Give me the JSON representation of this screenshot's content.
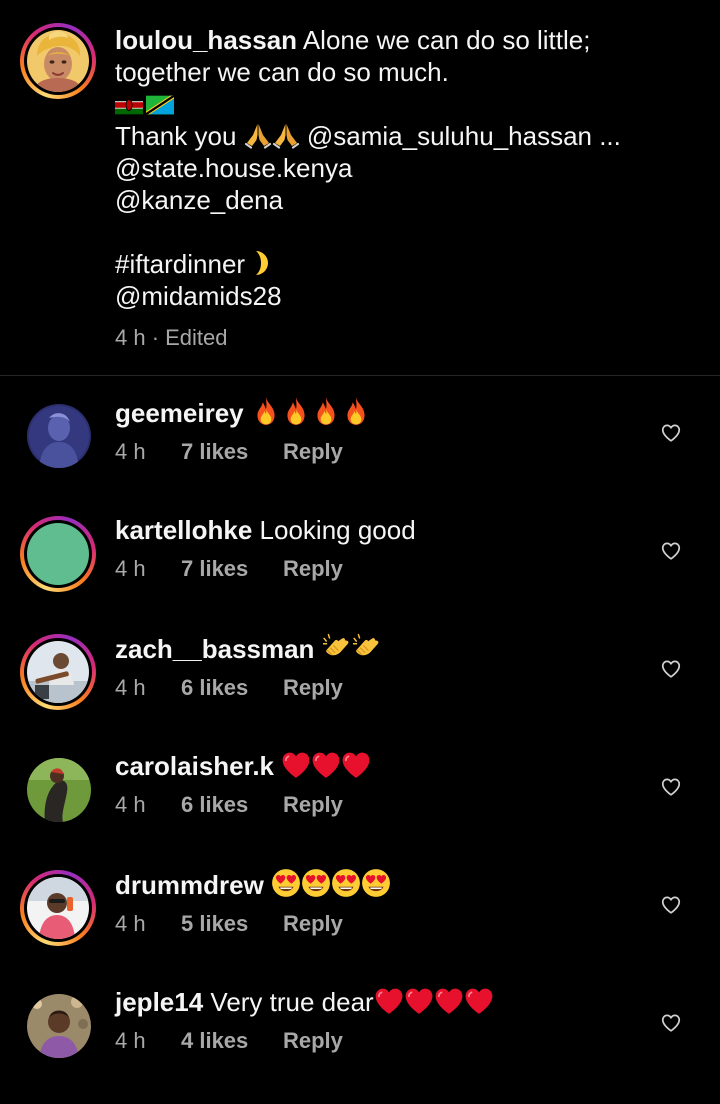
{
  "post": {
    "username": "loulou_hassan",
    "caption_first": "Alone we can do so little;",
    "caption_second": "together we can do so much.",
    "thank_you": " Thank you",
    "mention_1": " @samia_suluhu_hassan ...",
    "mention_2": "@state.house.kenya",
    "mention_3": "@kanze_dena",
    "hashtag": "#iftardinner",
    "mention_4": "@midamids28",
    "meta": "4 h · Edited"
  },
  "comments": [
    {
      "username": "geemeirey",
      "text": "",
      "emoji": "fire",
      "emoji_count": 4,
      "time": "4 h",
      "likes": "7 likes",
      "reply": "Reply"
    },
    {
      "username": "kartellohke",
      "text": "Looking good",
      "emoji": "",
      "emoji_count": 0,
      "time": "4 h",
      "likes": "7 likes",
      "reply": "Reply"
    },
    {
      "username": "zach__bassman",
      "text": "",
      "emoji": "clap",
      "emoji_count": 2,
      "time": "4 h",
      "likes": "6 likes",
      "reply": "Reply"
    },
    {
      "username": "carolaisher.k",
      "text": "",
      "emoji": "red-heart",
      "emoji_count": 3,
      "time": "4 h",
      "likes": "6 likes",
      "reply": "Reply"
    },
    {
      "username": "drummdrew",
      "text": "",
      "emoji": "heart-eyes",
      "emoji_count": 4,
      "time": "4 h",
      "likes": "5 likes",
      "reply": "Reply"
    },
    {
      "username": "jeple14",
      "text": "Very true dear",
      "emoji": "red-heart",
      "emoji_count": 4,
      "time": "4 h",
      "likes": "4 likes",
      "reply": "Reply"
    }
  ],
  "icons": {
    "like": "heart-outline-icon",
    "pray": "folded-hands-icon",
    "moon": "crescent-moon-icon",
    "flag_1": "kenya-flag-icon",
    "flag_2": "tanzania-flag-icon"
  },
  "colors": {
    "background": "#000000",
    "text": "#f5f5f5",
    "secondary_text": "#a8a8a8",
    "divider": "#262626"
  }
}
